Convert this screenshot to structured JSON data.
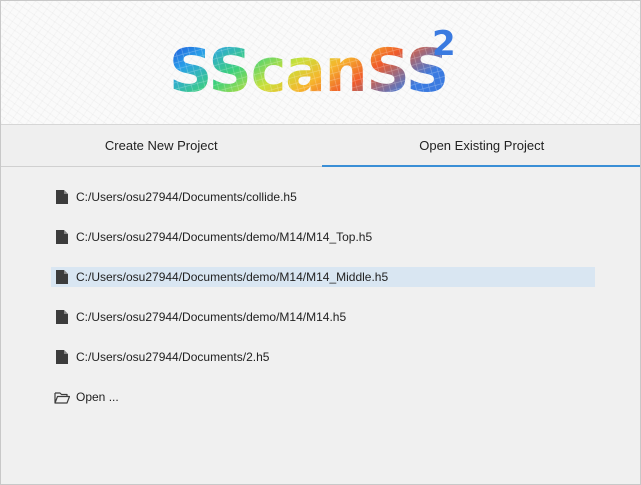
{
  "app": {
    "logo_text": "SScanSS",
    "logo_superscript": "2"
  },
  "tabs": [
    {
      "label": "Create New Project",
      "active": false
    },
    {
      "label": "Open Existing Project",
      "active": true
    }
  ],
  "recent_files": [
    {
      "path": "C:/Users/osu27944/Documents/collide.h5",
      "icon": "file-icon",
      "selected": false
    },
    {
      "path": "C:/Users/osu27944/Documents/demo/M14/M14_Top.h5",
      "icon": "file-icon",
      "selected": false
    },
    {
      "path": "C:/Users/osu27944/Documents/demo/M14/M14_Middle.h5",
      "icon": "file-icon",
      "selected": true
    },
    {
      "path": "C:/Users/osu27944/Documents/demo/M14/M14.h5",
      "icon": "file-icon",
      "selected": false
    },
    {
      "path": "C:/Users/osu27944/Documents/2.h5",
      "icon": "file-icon",
      "selected": false
    }
  ],
  "open_action": {
    "label": "Open ...",
    "icon": "folder-open-icon"
  },
  "colors": {
    "accent": "#3a8fd6",
    "selection": "#d9e6f2",
    "background": "#f0f0f0"
  }
}
